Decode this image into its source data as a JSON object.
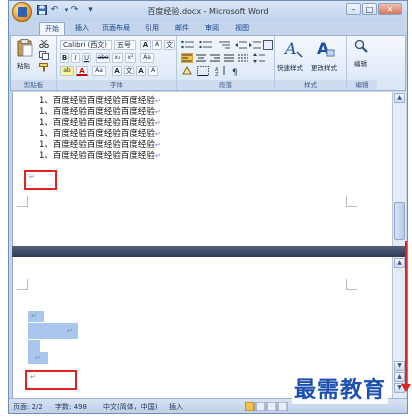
{
  "window": {
    "title": "百度经验.docx - Microsoft Word",
    "minimize": "–",
    "restore": "□",
    "close": "✕"
  },
  "quick_access": {
    "save_icon": "save-icon",
    "undo": "↶",
    "redo": "↷",
    "customize": "▾"
  },
  "tabs": [
    {
      "label": "开始",
      "active": true
    },
    {
      "label": "插入",
      "active": false
    },
    {
      "label": "页面布局",
      "active": false
    },
    {
      "label": "引用",
      "active": false
    },
    {
      "label": "邮件",
      "active": false
    },
    {
      "label": "审阅",
      "active": false
    },
    {
      "label": "视图",
      "active": false
    }
  ],
  "ribbon": {
    "clipboard": {
      "label": "剪贴板",
      "paste": "粘贴"
    },
    "font": {
      "label": "字体",
      "font_name": "Calibri (西文)",
      "font_size": "五号",
      "bold": "B",
      "italic": "I",
      "underline": "U",
      "strike": "abe",
      "subscript": "x₂",
      "superscript": "x²",
      "grow": "A",
      "shrink": "A",
      "wen": "文",
      "aa": "Aa",
      "highlight": "ab",
      "fontcolor": "A"
    },
    "paragraph": {
      "label": "段落"
    },
    "styles": {
      "label": "样式",
      "quick_styles": "快速样式",
      "change_styles": "更改样式"
    },
    "editing": {
      "label": "编辑",
      "edit": "编辑"
    }
  },
  "document": {
    "lines": [
      "1、百度经验百度经验百度经验",
      "1、百度经验百度经验百度经验",
      "1、百度经验百度经验百度经验",
      "1、百度经验百度经验百度经验",
      "1、百度经验百度经验百度经验",
      "1、百度经验百度经验百度经验"
    ],
    "paragraph_mark": "↵"
  },
  "status_bar": {
    "page": "页面: 2/2",
    "words": "字数: 498",
    "language": "中文(简体，中国)",
    "mode": "插入"
  },
  "watermark": "最需教育",
  "colors": {
    "accent": "#1b4fb0",
    "highlight_box": "#e0231c",
    "selection": "#a9c6ec"
  }
}
